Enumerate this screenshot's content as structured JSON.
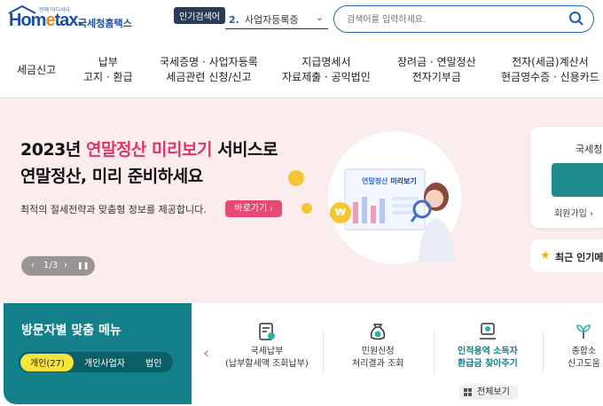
{
  "header": {
    "logo_text_home": "Hom",
    "logo_text_e": "e",
    "logo_text_tax": "tax.",
    "logo_small": "언제 어디서나",
    "site_name": "국세청홈택스",
    "popular_badge": "인기검색어",
    "popular_rank": "2.",
    "popular_term": "사업자등록증",
    "search_placeholder": "검색어를 입력하세요."
  },
  "nav": [
    {
      "line1": "세금신고",
      "line2": ""
    },
    {
      "line1": "납부",
      "line2": "고지 · 환급"
    },
    {
      "line1": "국세증명 · 사업자등록",
      "line2": "세금관련 신청/신고"
    },
    {
      "line1": "지급명세서",
      "line2": "자료제출 · 공익법인"
    },
    {
      "line1": "장려금 · 연말정산",
      "line2": "전자기부금"
    },
    {
      "line1": "전자(세금)계산서",
      "line2": "현금영수증 · 신용카드"
    }
  ],
  "hero": {
    "title_prefix": "2023년 ",
    "title_highlight": "연말정산 미리보기",
    "title_suffix": " 서비스로",
    "title_line2": "연말정산, 미리 준비하세요",
    "description": "최적의 절세전략과 맞춤형 정보를 제공합니다.",
    "cta_label": "바로가기 ›",
    "pager_prev": "‹",
    "pager_text": "1/3",
    "pager_next": "›",
    "pager_pause": "❚❚",
    "monitor_title_a": "연말정산",
    "monitor_title_b": " 미리보기"
  },
  "login": {
    "title": "국세청",
    "join_label": "회원가입 ›"
  },
  "recent": {
    "label": "최근 인기메"
  },
  "visitor_menu": {
    "title": "방문자별 맞춤 메뉴",
    "tabs": [
      {
        "label": "개인(27)",
        "active": true
      },
      {
        "label": "개인사업자",
        "active": false
      },
      {
        "label": "법인",
        "active": false
      }
    ]
  },
  "services": [
    {
      "line1": "국세납부",
      "line2": "(납부할세액 조회납부)",
      "icon": "tax-payment-icon",
      "highlight": false
    },
    {
      "line1": "민원신청",
      "line2": "처리결과 조회",
      "icon": "money-bag-icon",
      "highlight": false
    },
    {
      "line1": "인적용역 소득자",
      "line2": "환급금 찾아주기",
      "icon": "refund-icon",
      "highlight": true
    },
    {
      "line1": "종합소",
      "line2": "신고도움",
      "icon": "plant-icon",
      "highlight": false
    }
  ],
  "all_view_label": "전체보기",
  "colors": {
    "brand_blue": "#1e4f9c",
    "accent_pink": "#e0356a",
    "teal": "#14808a",
    "tab_yellow": "#f6e33b",
    "hero_bg": "#fbeded"
  }
}
